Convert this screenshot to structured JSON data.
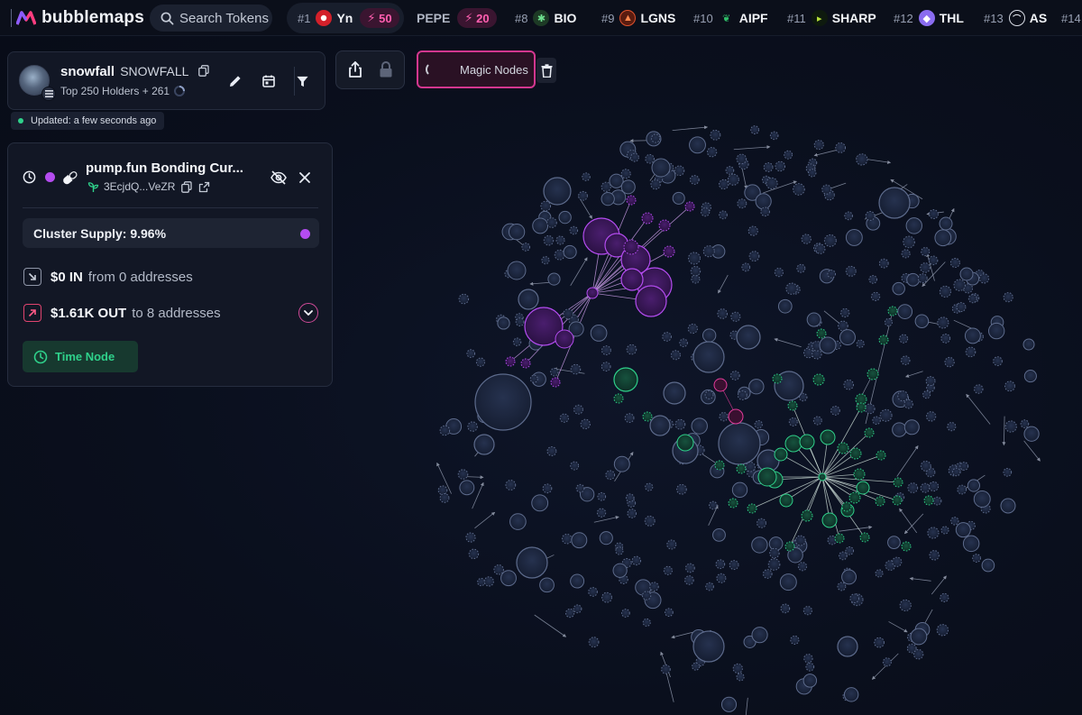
{
  "app": {
    "name": "bubblemaps"
  },
  "search": {
    "placeholder": "Search Tokens"
  },
  "tickers": [
    {
      "rank": "#1",
      "symbol": "Yn",
      "boost": "50",
      "icon": "red-circle-icon"
    },
    {
      "rank": "",
      "symbol": "PEPE",
      "boost": "20",
      "icon": ""
    },
    {
      "rank": "#8",
      "symbol": "BIO",
      "icon": "bio-icon"
    },
    {
      "rank": "#9",
      "symbol": "LGNS",
      "icon": "lgns-icon"
    },
    {
      "rank": "#10",
      "symbol": "AIPF",
      "icon": "leaf-icon"
    },
    {
      "rank": "#11",
      "symbol": "SHARP",
      "icon": "sharp-icon"
    },
    {
      "rank": "#12",
      "symbol": "THL",
      "icon": "thl-icon"
    },
    {
      "rank": "#13",
      "symbol": "AS",
      "icon": "as-icon"
    },
    {
      "rank": "#14",
      "symbol": "",
      "icon": ""
    }
  ],
  "token": {
    "name": "snowfall",
    "symbol": "SNOWFALL",
    "holders_label": "Top 250 Holders + 261",
    "updated": "Updated: a few seconds ago"
  },
  "toolbar": {
    "magic_nodes": "Magic Nodes"
  },
  "cluster": {
    "title": "pump.fun Bonding Cur...",
    "address": "3EcjdQ...VeZR",
    "supply": "Cluster Supply: 9.96%",
    "in_amount": "$0 IN",
    "in_text": "from 0 addresses",
    "out_amount": "$1.61K OUT",
    "out_text": "to 8 addresses",
    "time_node": "Time Node"
  },
  "colors": {
    "accent_purple": "#b44cf0",
    "accent_green": "#2fd18b",
    "accent_pink": "#d3378f",
    "node_default": "#1d2740"
  }
}
